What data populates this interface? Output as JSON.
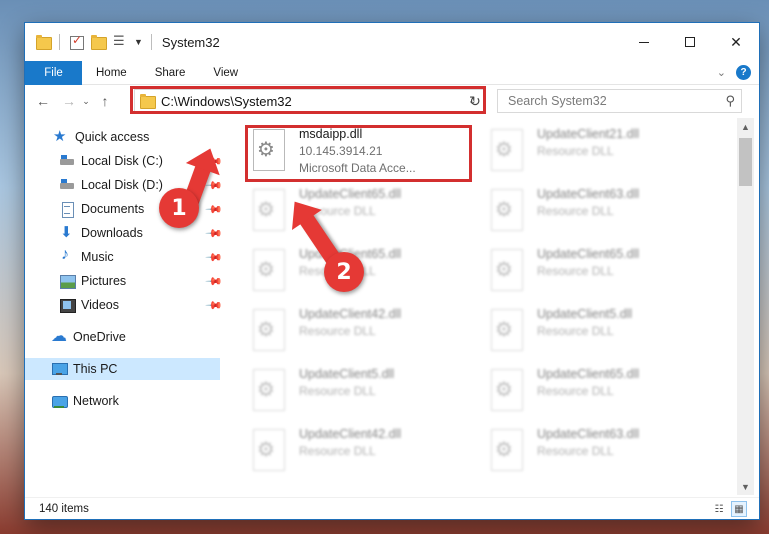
{
  "window": {
    "title": "System32"
  },
  "ribbon": {
    "tabs": [
      "File",
      "Home",
      "Share",
      "View"
    ]
  },
  "address": {
    "path": "C:\\Windows\\System32"
  },
  "search": {
    "placeholder": "Search System32"
  },
  "sidebar": {
    "items": [
      {
        "label": "Quick access",
        "icon": "star-icon"
      },
      {
        "label": "Local Disk (C:)",
        "icon": "drive-icon",
        "pinned": true
      },
      {
        "label": "Local Disk (D:)",
        "icon": "drive-icon",
        "pinned": true
      },
      {
        "label": "Documents",
        "icon": "documents-icon",
        "pinned": true
      },
      {
        "label": "Downloads",
        "icon": "downloads-icon",
        "pinned": true
      },
      {
        "label": "Music",
        "icon": "music-icon",
        "pinned": true
      },
      {
        "label": "Pictures",
        "icon": "pictures-icon",
        "pinned": true
      },
      {
        "label": "Videos",
        "icon": "videos-icon",
        "pinned": true
      },
      {
        "label": "OneDrive",
        "icon": "onedrive-icon"
      },
      {
        "label": "This PC",
        "icon": "this-pc-icon",
        "selected": true
      },
      {
        "label": "Network",
        "icon": "network-icon"
      }
    ]
  },
  "files": {
    "left": [
      {
        "name": "msdaipp.dll",
        "line2": "10.145.3914.21",
        "line3": "Microsoft Data Acce..."
      },
      {
        "name": "UpdateClient65.dll",
        "line2": "Resource DLL"
      },
      {
        "name": "UpdateClient65.dll",
        "line2": "Resource DLL"
      },
      {
        "name": "UpdateClient42.dll",
        "line2": "Resource DLL"
      },
      {
        "name": "UpdateClient5.dll",
        "line2": "Resource DLL"
      },
      {
        "name": "UpdateClient42.dll",
        "line2": "Resource DLL"
      }
    ],
    "right": [
      {
        "name": "UpdateClient21.dll",
        "line2": "Resource DLL"
      },
      {
        "name": "UpdateClient63.dll",
        "line2": "Resource DLL"
      },
      {
        "name": "UpdateClient65.dll",
        "line2": "Resource DLL"
      },
      {
        "name": "UpdateClient5.dll",
        "line2": "Resource DLL"
      },
      {
        "name": "UpdateClient65.dll",
        "line2": "Resource DLL"
      },
      {
        "name": "UpdateClient63.dll",
        "line2": "Resource DLL"
      }
    ]
  },
  "status": {
    "count": "140 items"
  },
  "annotations": {
    "badge1": "1",
    "badge2": "2",
    "color": "#e53935"
  }
}
